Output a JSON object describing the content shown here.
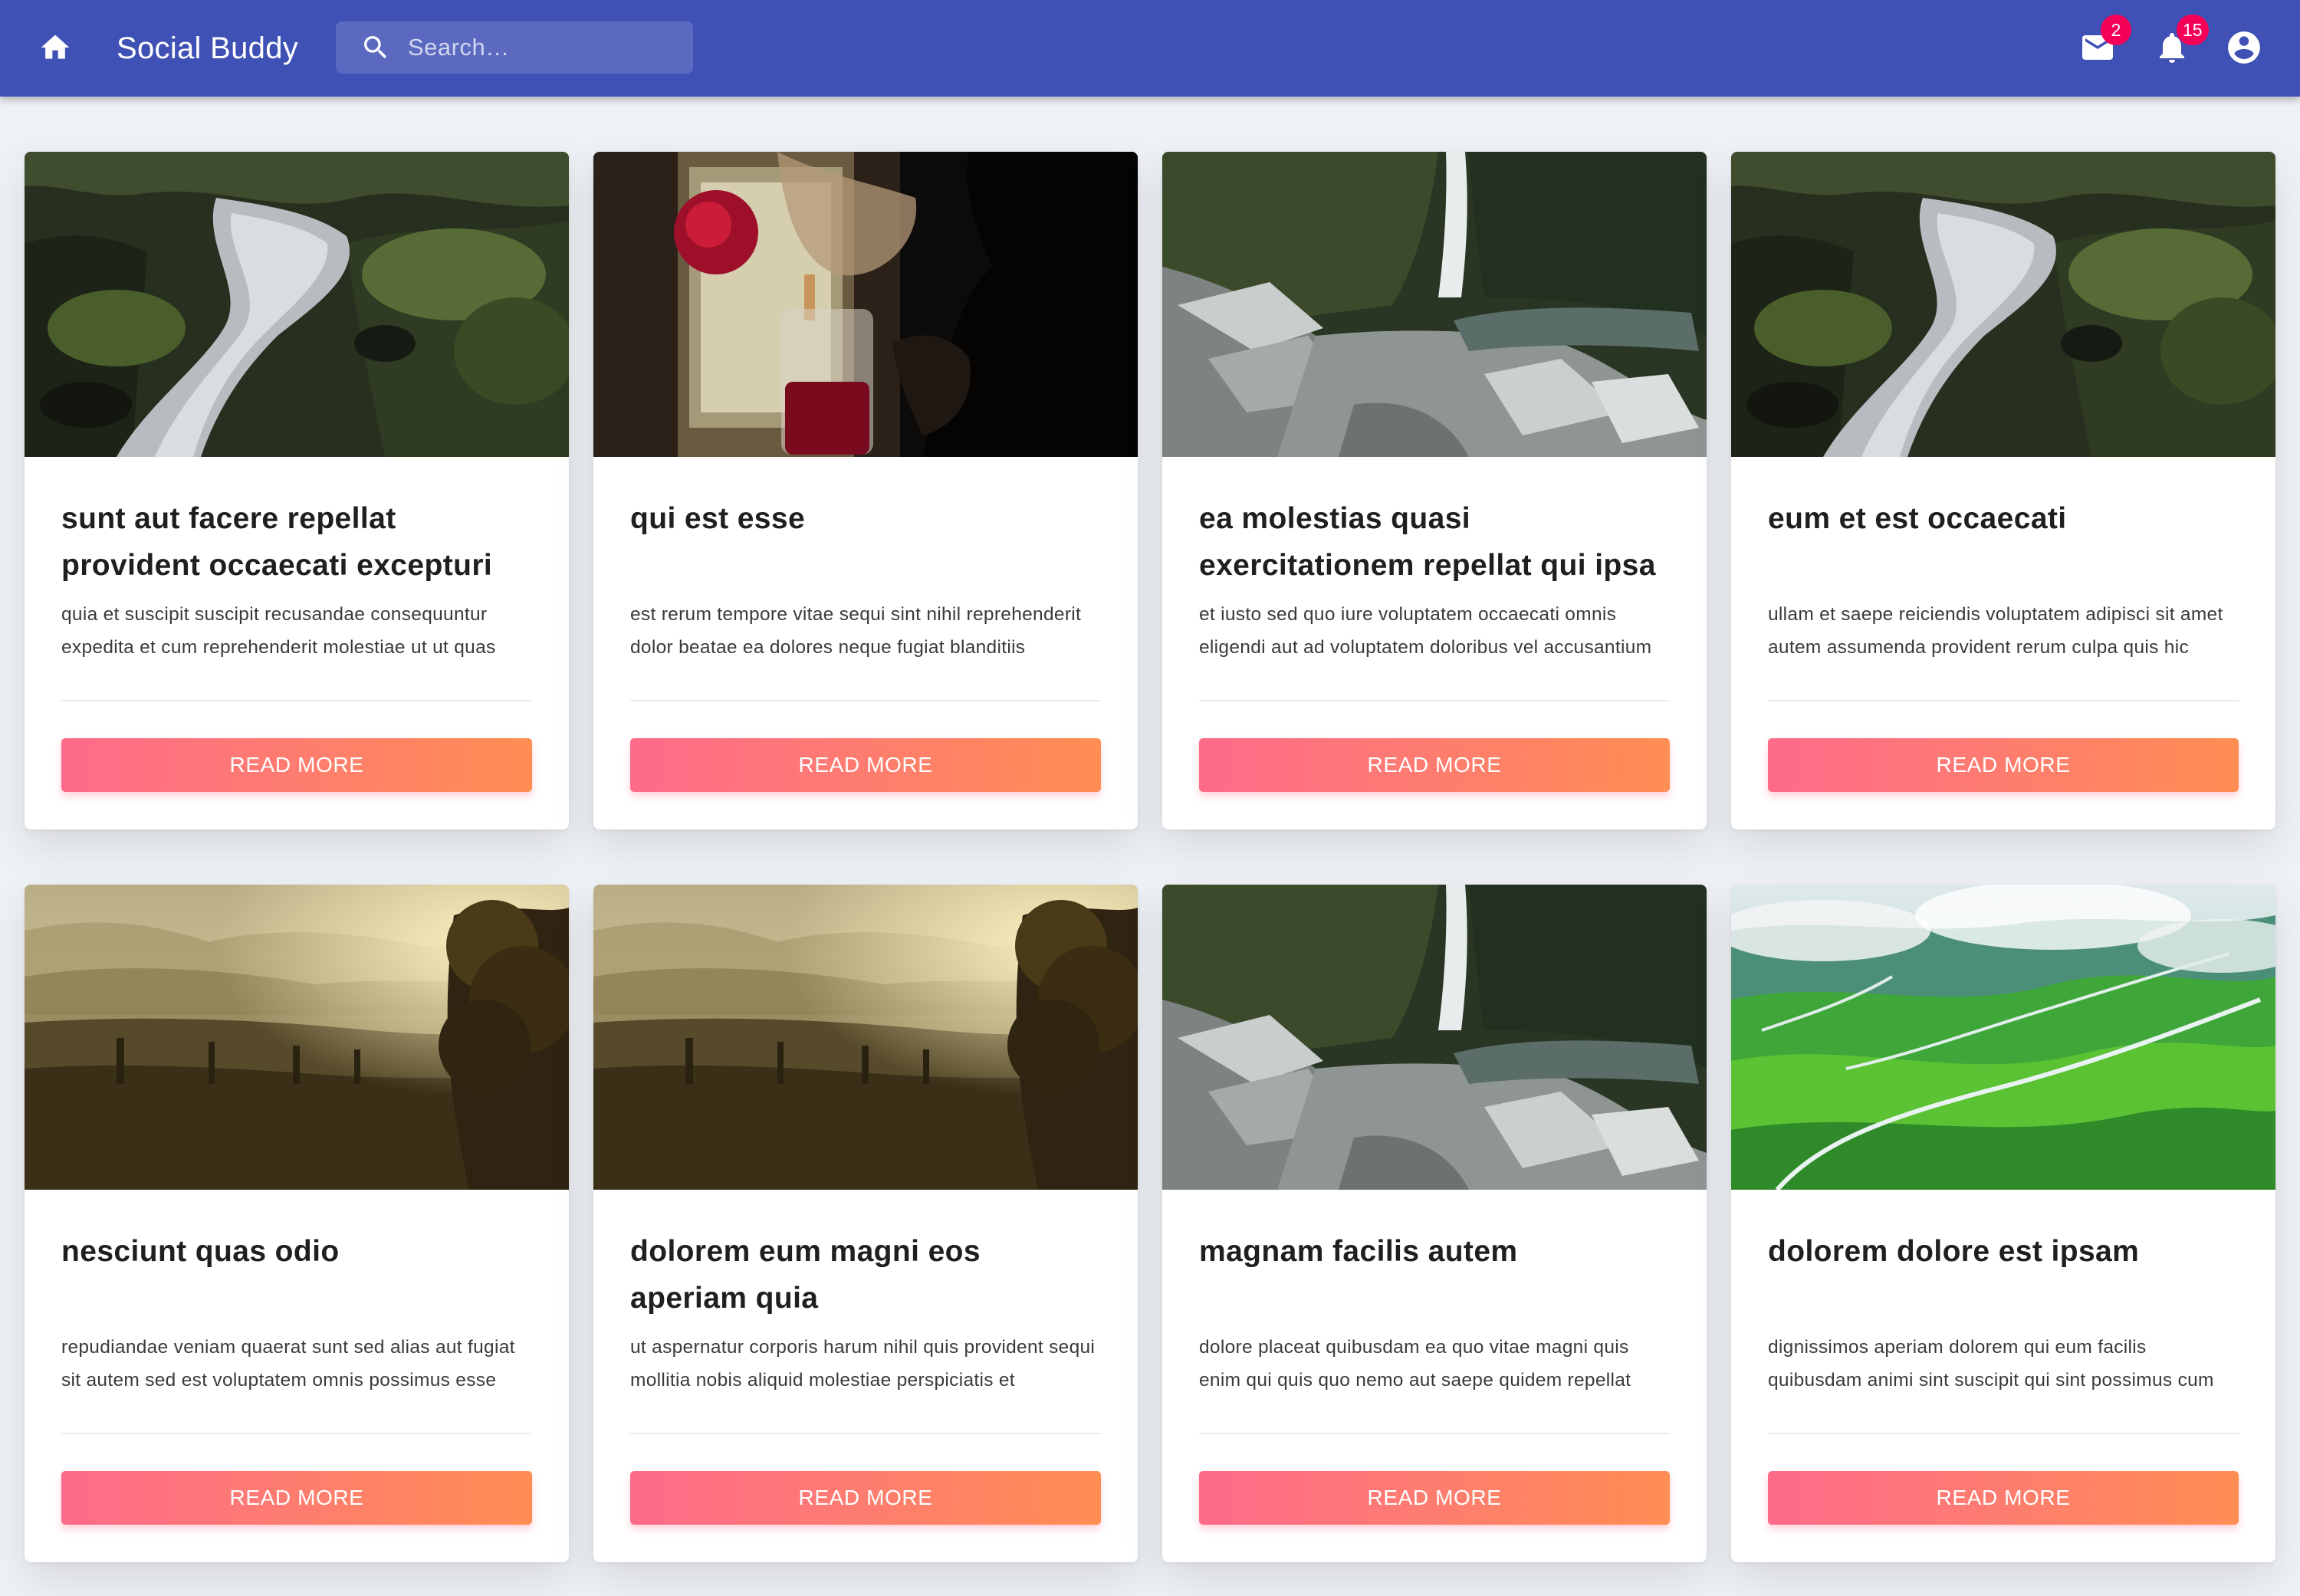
{
  "appbar": {
    "title": "Social Buddy",
    "search_placeholder": "Search…",
    "home_icon": "home-icon",
    "mail_icon": "mail-icon",
    "mail_badge": "2",
    "notifications_icon": "bell-icon",
    "notifications_badge": "15",
    "account_icon": "account-circle-icon",
    "color": "#3f51b5",
    "badge_color": "#f50057"
  },
  "button_gradient": [
    "#fe6b8b",
    "#ff8e53"
  ],
  "posts": [
    {
      "title": "sunt aut facere repellat provident occaecati excepturi",
      "body": "quia et suscipit suscipit recusandae consequuntur expedita et cum reprehenderit molestiae ut ut quas",
      "button": "READ MORE",
      "image": "waterfall-stream"
    },
    {
      "title": "qui est esse",
      "body": "est rerum tempore vitae sequi sint nihil reprehenderit dolor beatae ea dolores neque fugiat blanditiis",
      "button": "READ MORE",
      "image": "pour-over-coffee"
    },
    {
      "title": "ea molestias quasi exercitationem repellat qui ipsa",
      "body": "et iusto sed quo iure voluptatem occaecati omnis eligendi aut ad voluptatem doloribus vel accusantium",
      "button": "READ MORE",
      "image": "rocky-gorge-waterfall"
    },
    {
      "title": "eum et est occaecati",
      "body": "ullam et saepe reiciendis voluptatem adipisci sit amet autem assumenda provident rerum culpa quis hic",
      "button": "READ MORE",
      "image": "waterfall-stream"
    },
    {
      "title": "nesciunt quas odio",
      "body": "repudiandae veniam quaerat sunt sed alias aut fugiat sit autem sed est voluptatem omnis possimus esse",
      "button": "READ MORE",
      "image": "misty-hills-sunrise"
    },
    {
      "title": "dolorem eum magni eos aperiam quia",
      "body": "ut aspernatur corporis harum nihil quis provident sequi mollitia nobis aliquid molestiae perspiciatis et",
      "button": "READ MORE",
      "image": "misty-hills-sunrise"
    },
    {
      "title": "magnam facilis autem",
      "body": "dolore placeat quibusdam ea quo vitae magni quis enim qui quis quo nemo aut saepe quidem repellat",
      "button": "READ MORE",
      "image": "rocky-gorge-waterfall"
    },
    {
      "title": "dolorem dolore est ipsam",
      "body": "dignissimos aperiam dolorem qui eum facilis quibusdam animi sint suscipit qui sint possimus cum",
      "button": "READ MORE",
      "image": "green-valley-streams"
    }
  ]
}
